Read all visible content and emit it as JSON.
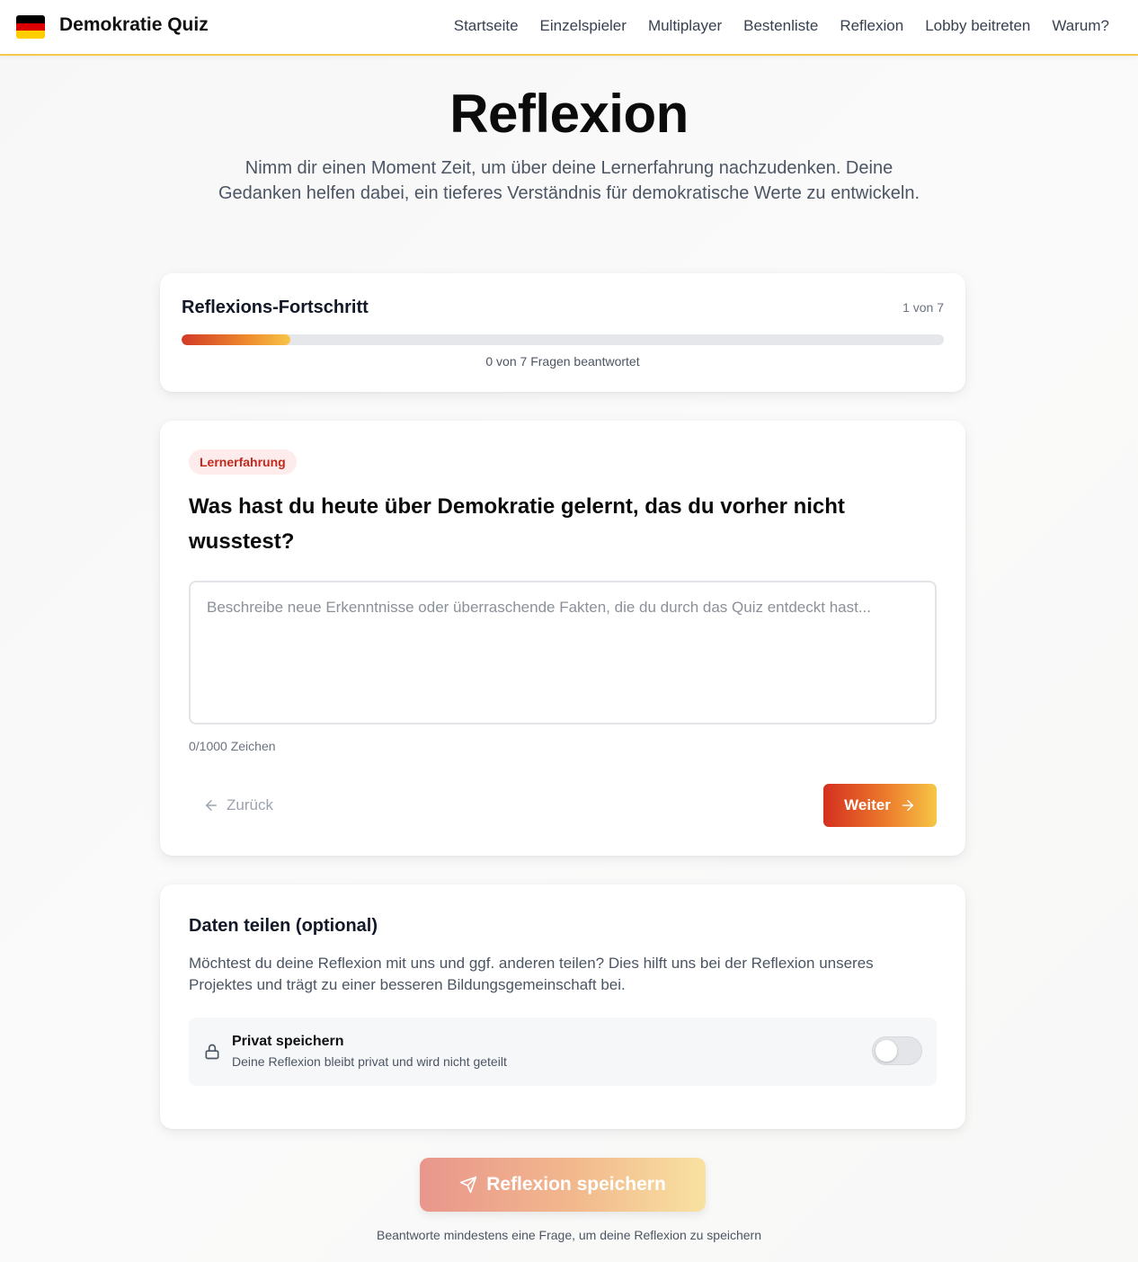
{
  "header": {
    "brand": "Demokratie Quiz",
    "flag_colors": [
      "#000000",
      "#dd0000",
      "#ffce00"
    ],
    "nav": [
      "Startseite",
      "Einzelspieler",
      "Multiplayer",
      "Bestenliste",
      "Reflexion",
      "Lobby beitreten",
      "Warum?"
    ]
  },
  "hero": {
    "title": "Reflexion",
    "subtitle": "Nimm dir einen Moment Zeit, um über deine Lernerfahrung nachzudenken. Deine Gedanken helfen dabei, ein tieferes Verständnis für demokratische Werte zu entwickeln."
  },
  "progress": {
    "title": "Reflexions-Fortschritt",
    "count": "1 von 7",
    "fraction": 0.143,
    "note": "0 von 7 Fragen beantwortet"
  },
  "question": {
    "badge": "Lernerfahrung",
    "text": "Was hast du heute über Demokratie gelernt, das du vorher nicht wusstest?",
    "value": "",
    "placeholder": "Beschreibe neue Erkenntnisse oder überraschende Fakten, die du durch das Quiz entdeckt hast...",
    "char_count": "0/1000 Zeichen",
    "back_label": "Zurück",
    "next_label": "Weiter"
  },
  "share": {
    "title": "Daten teilen (optional)",
    "text": "Möchtest du deine Reflexion mit uns und ggf. anderen teilen? Dies hilft uns bei der Reflexion unseres Projektes und trägt zu einer besseren Bildungsgemeinschaft bei.",
    "private_title": "Privat speichern",
    "private_sub": "Deine Reflexion bleibt privat und wird nicht geteilt",
    "toggle_on": false
  },
  "save": {
    "label": "Reflexion speichern",
    "hint": "Beantworte mindestens eine Frage, um deine Reflexion zu speichern"
  },
  "icons": {
    "back": "arrow-left-icon",
    "next": "arrow-right-icon",
    "lock": "lock-icon",
    "save": "send-icon"
  }
}
